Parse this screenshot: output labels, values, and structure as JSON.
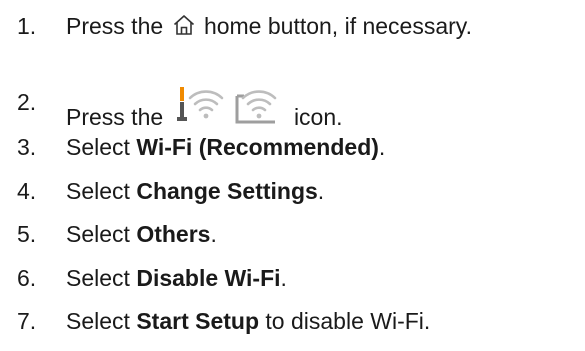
{
  "steps": [
    {
      "number": "1.",
      "pre": "Press the",
      "icon": "home-icon",
      "post": "home button, if necessary."
    },
    {
      "number": "2.",
      "pre": "Press the",
      "icon": "wifi-status-icons",
      "post": "icon."
    },
    {
      "number": "3.",
      "pre": "Select ",
      "bold": "Wi-Fi (Recommended)",
      "post": "."
    },
    {
      "number": "4.",
      "pre": "Select ",
      "bold": "Change Settings",
      "post": "."
    },
    {
      "number": "5.",
      "pre": "Select ",
      "bold": "Others",
      "post": "."
    },
    {
      "number": "6.",
      "pre": "Select ",
      "bold": "Disable Wi-Fi",
      "post": "."
    },
    {
      "number": "7.",
      "pre": "Select ",
      "bold": "Start Setup",
      "post": " to disable Wi-Fi."
    }
  ]
}
